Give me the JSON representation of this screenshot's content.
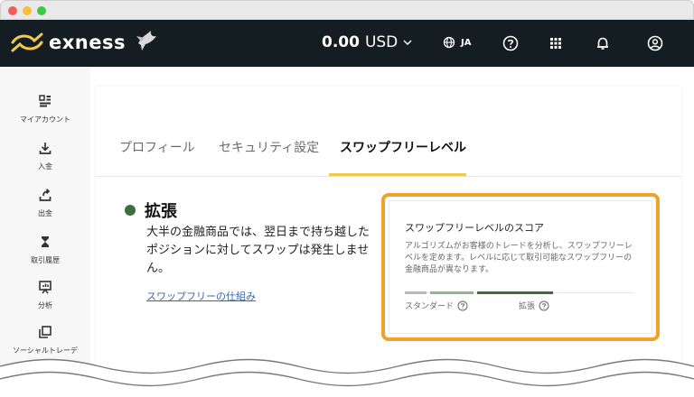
{
  "brand": {
    "name": "exness",
    "accent": "#f2c94c",
    "navbar_bg": "#141d22"
  },
  "topbar": {
    "balance_amount": "0.00",
    "balance_currency": "USD",
    "language": "JA",
    "icons": [
      "globe-icon",
      "help-icon",
      "apps-grid-icon",
      "bell-icon",
      "account-icon"
    ]
  },
  "sidebar": {
    "items": [
      {
        "label": "マイアカウント",
        "icon": "dashboard-icon"
      },
      {
        "label": "入金",
        "icon": "deposit-icon"
      },
      {
        "label": "出金",
        "icon": "withdraw-icon"
      },
      {
        "label": "取引履歴",
        "icon": "hourglass-icon"
      },
      {
        "label": "分析",
        "icon": "analytics-icon"
      },
      {
        "label": "ソーシャルトレーデ",
        "icon": "copy-icon"
      }
    ]
  },
  "tabs": [
    {
      "label": "プロフィール",
      "active": false
    },
    {
      "label": "セキュリティ設定",
      "active": false
    },
    {
      "label": "スワップフリーレベル",
      "active": true
    }
  ],
  "level": {
    "title": "拡張",
    "color": "#3e6e3f",
    "description": "大半の金融商品では、翌日まで持ち越したポジションに対してスワップは発生しません。",
    "link": "スワップフリーの仕組み"
  },
  "score": {
    "title": "スワップフリーレベルのスコア",
    "description": "アルゴリズムがお客様のトレードを分析し、スワップフリーレベルを定めます。レベルに応じて取引可能なスワップフリーの金融商品が異なります。",
    "labels": [
      "スタンダード",
      "拡張"
    ],
    "highlight_color": "#f0a22c"
  }
}
